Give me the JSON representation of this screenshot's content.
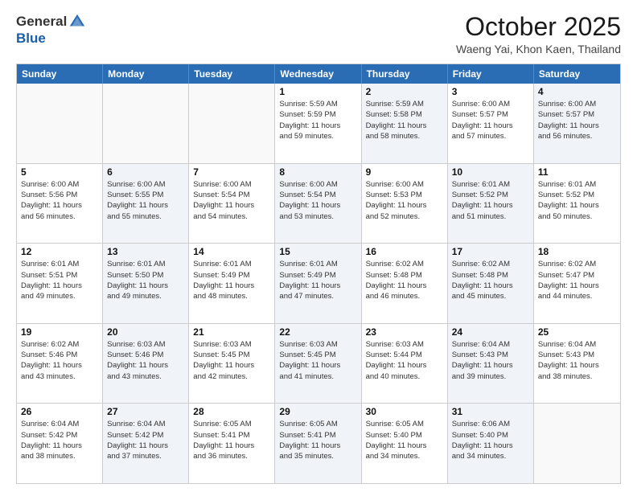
{
  "header": {
    "logo": {
      "general": "General",
      "blue": "Blue"
    },
    "month": "October 2025",
    "location": "Waeng Yai, Khon Kaen, Thailand"
  },
  "weekdays": [
    "Sunday",
    "Monday",
    "Tuesday",
    "Wednesday",
    "Thursday",
    "Friday",
    "Saturday"
  ],
  "weeks": [
    [
      {
        "day": "",
        "info": "",
        "shaded": false,
        "empty": true
      },
      {
        "day": "",
        "info": "",
        "shaded": false,
        "empty": true
      },
      {
        "day": "",
        "info": "",
        "shaded": false,
        "empty": true
      },
      {
        "day": "1",
        "info": "Sunrise: 5:59 AM\nSunset: 5:59 PM\nDaylight: 11 hours\nand 59 minutes.",
        "shaded": false,
        "empty": false
      },
      {
        "day": "2",
        "info": "Sunrise: 5:59 AM\nSunset: 5:58 PM\nDaylight: 11 hours\nand 58 minutes.",
        "shaded": true,
        "empty": false
      },
      {
        "day": "3",
        "info": "Sunrise: 6:00 AM\nSunset: 5:57 PM\nDaylight: 11 hours\nand 57 minutes.",
        "shaded": false,
        "empty": false
      },
      {
        "day": "4",
        "info": "Sunrise: 6:00 AM\nSunset: 5:57 PM\nDaylight: 11 hours\nand 56 minutes.",
        "shaded": true,
        "empty": false
      }
    ],
    [
      {
        "day": "5",
        "info": "Sunrise: 6:00 AM\nSunset: 5:56 PM\nDaylight: 11 hours\nand 56 minutes.",
        "shaded": false,
        "empty": false
      },
      {
        "day": "6",
        "info": "Sunrise: 6:00 AM\nSunset: 5:55 PM\nDaylight: 11 hours\nand 55 minutes.",
        "shaded": true,
        "empty": false
      },
      {
        "day": "7",
        "info": "Sunrise: 6:00 AM\nSunset: 5:54 PM\nDaylight: 11 hours\nand 54 minutes.",
        "shaded": false,
        "empty": false
      },
      {
        "day": "8",
        "info": "Sunrise: 6:00 AM\nSunset: 5:54 PM\nDaylight: 11 hours\nand 53 minutes.",
        "shaded": true,
        "empty": false
      },
      {
        "day": "9",
        "info": "Sunrise: 6:00 AM\nSunset: 5:53 PM\nDaylight: 11 hours\nand 52 minutes.",
        "shaded": false,
        "empty": false
      },
      {
        "day": "10",
        "info": "Sunrise: 6:01 AM\nSunset: 5:52 PM\nDaylight: 11 hours\nand 51 minutes.",
        "shaded": true,
        "empty": false
      },
      {
        "day": "11",
        "info": "Sunrise: 6:01 AM\nSunset: 5:52 PM\nDaylight: 11 hours\nand 50 minutes.",
        "shaded": false,
        "empty": false
      }
    ],
    [
      {
        "day": "12",
        "info": "Sunrise: 6:01 AM\nSunset: 5:51 PM\nDaylight: 11 hours\nand 49 minutes.",
        "shaded": false,
        "empty": false
      },
      {
        "day": "13",
        "info": "Sunrise: 6:01 AM\nSunset: 5:50 PM\nDaylight: 11 hours\nand 49 minutes.",
        "shaded": true,
        "empty": false
      },
      {
        "day": "14",
        "info": "Sunrise: 6:01 AM\nSunset: 5:49 PM\nDaylight: 11 hours\nand 48 minutes.",
        "shaded": false,
        "empty": false
      },
      {
        "day": "15",
        "info": "Sunrise: 6:01 AM\nSunset: 5:49 PM\nDaylight: 11 hours\nand 47 minutes.",
        "shaded": true,
        "empty": false
      },
      {
        "day": "16",
        "info": "Sunrise: 6:02 AM\nSunset: 5:48 PM\nDaylight: 11 hours\nand 46 minutes.",
        "shaded": false,
        "empty": false
      },
      {
        "day": "17",
        "info": "Sunrise: 6:02 AM\nSunset: 5:48 PM\nDaylight: 11 hours\nand 45 minutes.",
        "shaded": true,
        "empty": false
      },
      {
        "day": "18",
        "info": "Sunrise: 6:02 AM\nSunset: 5:47 PM\nDaylight: 11 hours\nand 44 minutes.",
        "shaded": false,
        "empty": false
      }
    ],
    [
      {
        "day": "19",
        "info": "Sunrise: 6:02 AM\nSunset: 5:46 PM\nDaylight: 11 hours\nand 43 minutes.",
        "shaded": false,
        "empty": false
      },
      {
        "day": "20",
        "info": "Sunrise: 6:03 AM\nSunset: 5:46 PM\nDaylight: 11 hours\nand 43 minutes.",
        "shaded": true,
        "empty": false
      },
      {
        "day": "21",
        "info": "Sunrise: 6:03 AM\nSunset: 5:45 PM\nDaylight: 11 hours\nand 42 minutes.",
        "shaded": false,
        "empty": false
      },
      {
        "day": "22",
        "info": "Sunrise: 6:03 AM\nSunset: 5:45 PM\nDaylight: 11 hours\nand 41 minutes.",
        "shaded": true,
        "empty": false
      },
      {
        "day": "23",
        "info": "Sunrise: 6:03 AM\nSunset: 5:44 PM\nDaylight: 11 hours\nand 40 minutes.",
        "shaded": false,
        "empty": false
      },
      {
        "day": "24",
        "info": "Sunrise: 6:04 AM\nSunset: 5:43 PM\nDaylight: 11 hours\nand 39 minutes.",
        "shaded": true,
        "empty": false
      },
      {
        "day": "25",
        "info": "Sunrise: 6:04 AM\nSunset: 5:43 PM\nDaylight: 11 hours\nand 38 minutes.",
        "shaded": false,
        "empty": false
      }
    ],
    [
      {
        "day": "26",
        "info": "Sunrise: 6:04 AM\nSunset: 5:42 PM\nDaylight: 11 hours\nand 38 minutes.",
        "shaded": false,
        "empty": false
      },
      {
        "day": "27",
        "info": "Sunrise: 6:04 AM\nSunset: 5:42 PM\nDaylight: 11 hours\nand 37 minutes.",
        "shaded": true,
        "empty": false
      },
      {
        "day": "28",
        "info": "Sunrise: 6:05 AM\nSunset: 5:41 PM\nDaylight: 11 hours\nand 36 minutes.",
        "shaded": false,
        "empty": false
      },
      {
        "day": "29",
        "info": "Sunrise: 6:05 AM\nSunset: 5:41 PM\nDaylight: 11 hours\nand 35 minutes.",
        "shaded": true,
        "empty": false
      },
      {
        "day": "30",
        "info": "Sunrise: 6:05 AM\nSunset: 5:40 PM\nDaylight: 11 hours\nand 34 minutes.",
        "shaded": false,
        "empty": false
      },
      {
        "day": "31",
        "info": "Sunrise: 6:06 AM\nSunset: 5:40 PM\nDaylight: 11 hours\nand 34 minutes.",
        "shaded": true,
        "empty": false
      },
      {
        "day": "",
        "info": "",
        "shaded": false,
        "empty": true
      }
    ]
  ]
}
